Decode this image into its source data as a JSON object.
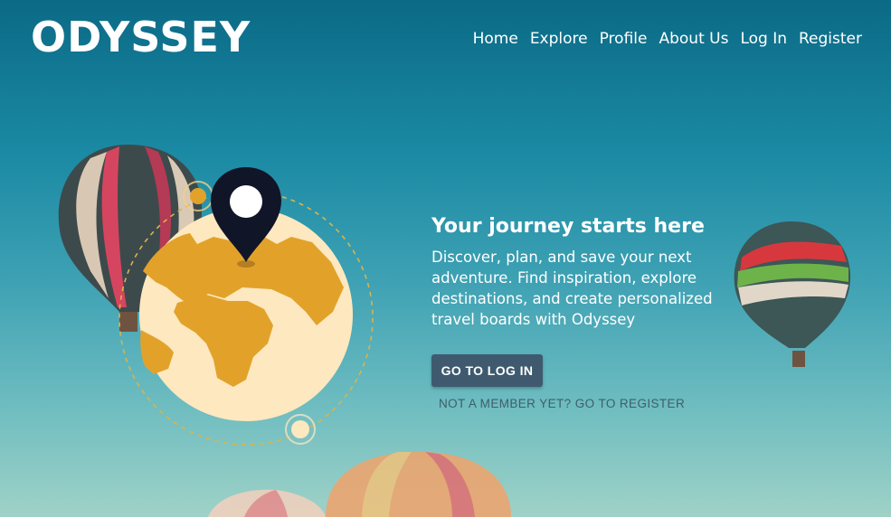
{
  "header": {
    "logo": "ODYSSEY",
    "nav": [
      {
        "label": "Home"
      },
      {
        "label": "Explore"
      },
      {
        "label": "Profile"
      },
      {
        "label": "About Us"
      },
      {
        "label": "Log In"
      },
      {
        "label": "Register"
      }
    ]
  },
  "hero": {
    "title": "Your journey starts here",
    "description": "Discover, plan, and save your next adventure. Find inspiration, explore destinations, and create personalized travel boards with Odyssey",
    "login_button": "GO TO LOG IN",
    "register_link": "NOT A MEMBER YET? GO TO REGISTER"
  },
  "icons": {
    "globe": "globe-icon",
    "pin": "location-pin-icon",
    "balloon": "hot-air-balloon"
  },
  "colors": {
    "button": "#3f5a6e",
    "globe_land": "#e2a22a",
    "globe_ocean": "#fde8c0",
    "pin": "#111528"
  }
}
